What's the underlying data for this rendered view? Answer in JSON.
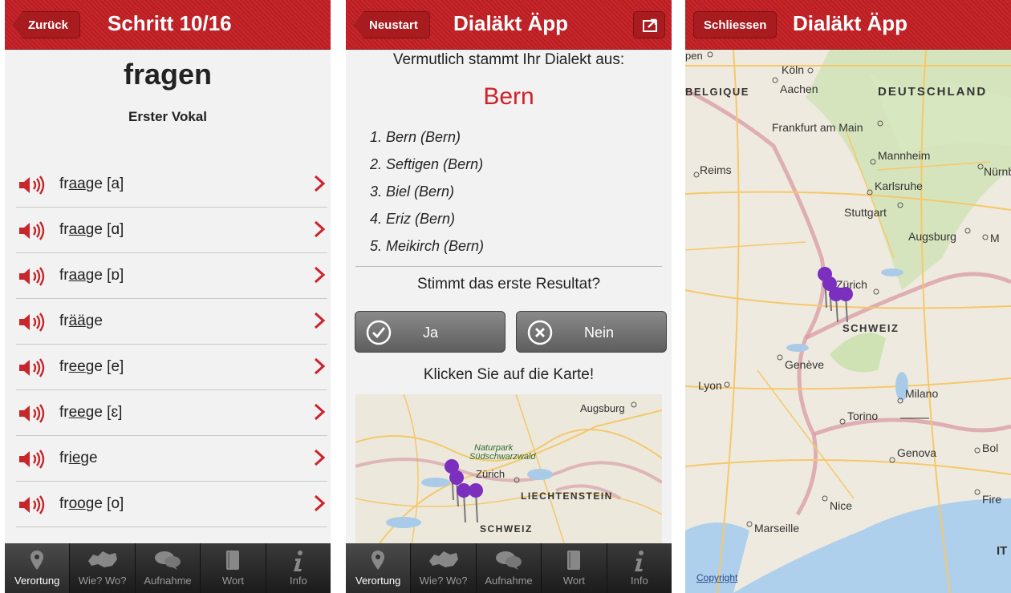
{
  "screen1": {
    "back_label": "Zurück",
    "title": "Schritt 10/16",
    "word": "fragen",
    "subtitle": "Erster Vokal",
    "items": [
      {
        "pre": "fr",
        "u": "aa",
        "post": "ge [a]"
      },
      {
        "pre": "fr",
        "u": "aa",
        "post": "ge [ɑ]"
      },
      {
        "pre": "fr",
        "u": "aa",
        "post": "ge [ɒ]"
      },
      {
        "pre": "fr",
        "u": "ää",
        "post": "ge"
      },
      {
        "pre": "fr",
        "u": "ee",
        "post": "ge [e]"
      },
      {
        "pre": "fr",
        "u": "ee",
        "post": "ge [ɛ]"
      },
      {
        "pre": "fr",
        "u": "ie",
        "post": "ge"
      },
      {
        "pre": "fr",
        "u": "oo",
        "post": "ge [o]"
      }
    ]
  },
  "screen2": {
    "back_label": "Neustart",
    "title": "Dialäkt Äpp",
    "question": "Vermutlich stammt Ihr Dialekt aus:",
    "result": "Bern",
    "results": [
      "1. Bern (Bern)",
      "2. Seftigen (Bern)",
      "3. Biel (Bern)",
      "4. Eriz (Bern)",
      "5. Meikirch (Bern)"
    ],
    "confirm_question": "Stimmt das erste Resultat?",
    "yes_label": "Ja",
    "no_label": "Nein",
    "map_hint": "Klicken Sie auf die Karte!",
    "map_labels": {
      "augsburg": "Augsburg",
      "naturpark1": "Naturpark",
      "naturpark2": "Südschwarzwald",
      "zurich": "Zürich",
      "liechtenstein": "LIECHTENSTEIN",
      "schweiz": "SCHWEIZ"
    }
  },
  "screen3": {
    "close_label": "Schliessen",
    "title": "Dialäkt Äpp",
    "copyright": "Copyright",
    "map_labels": {
      "koln": "Köln",
      "aachen": "Aachen",
      "belgique": "BELGIQUE",
      "deutschland": "DEUTSCHLAND",
      "frankfurt": "Frankfurt am Main",
      "mannheim": "Mannheim",
      "reims": "Reims",
      "nurnberg": "Nürnb",
      "karlsruhe": "Karlsruhe",
      "stuttgart": "Stuttgart",
      "augsburg": "Augsburg",
      "m": "M",
      "zurich": "Zürich",
      "schweiz": "SCHWEIZ",
      "geneve": "Genève",
      "lyon": "Lyon",
      "milano": "Milano",
      "torino": "Torino",
      "genova": "Genova",
      "bol": "Bol",
      "nice": "Nice",
      "fire": "Fire",
      "marseille": "Marseille",
      "it": "IT",
      "pen": "pen"
    }
  },
  "tabs": [
    {
      "label": "Verortung",
      "icon": "pin-icon"
    },
    {
      "label": "Wie? Wo?",
      "icon": "switzerland-icon"
    },
    {
      "label": "Aufnahme",
      "icon": "speech-bubbles-icon"
    },
    {
      "label": "Wort",
      "icon": "book-icon"
    },
    {
      "label": "Info",
      "icon": "info-icon"
    }
  ],
  "colors": {
    "accent": "#c7262a",
    "result": "#d0202a",
    "pin": "#7b2fbf"
  }
}
